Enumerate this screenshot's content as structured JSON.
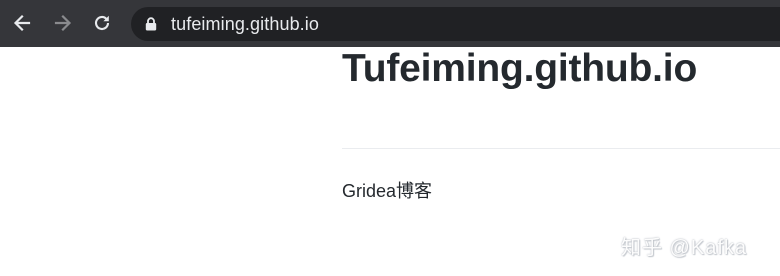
{
  "browser": {
    "url": "tufeiming.github.io",
    "toolbar_bg": "#35363a",
    "omnibox_bg": "#202124"
  },
  "page": {
    "title": "Tufeiming.github.io",
    "description": "Gridea博客"
  },
  "watermark": {
    "text": "知乎 @Kafka"
  }
}
